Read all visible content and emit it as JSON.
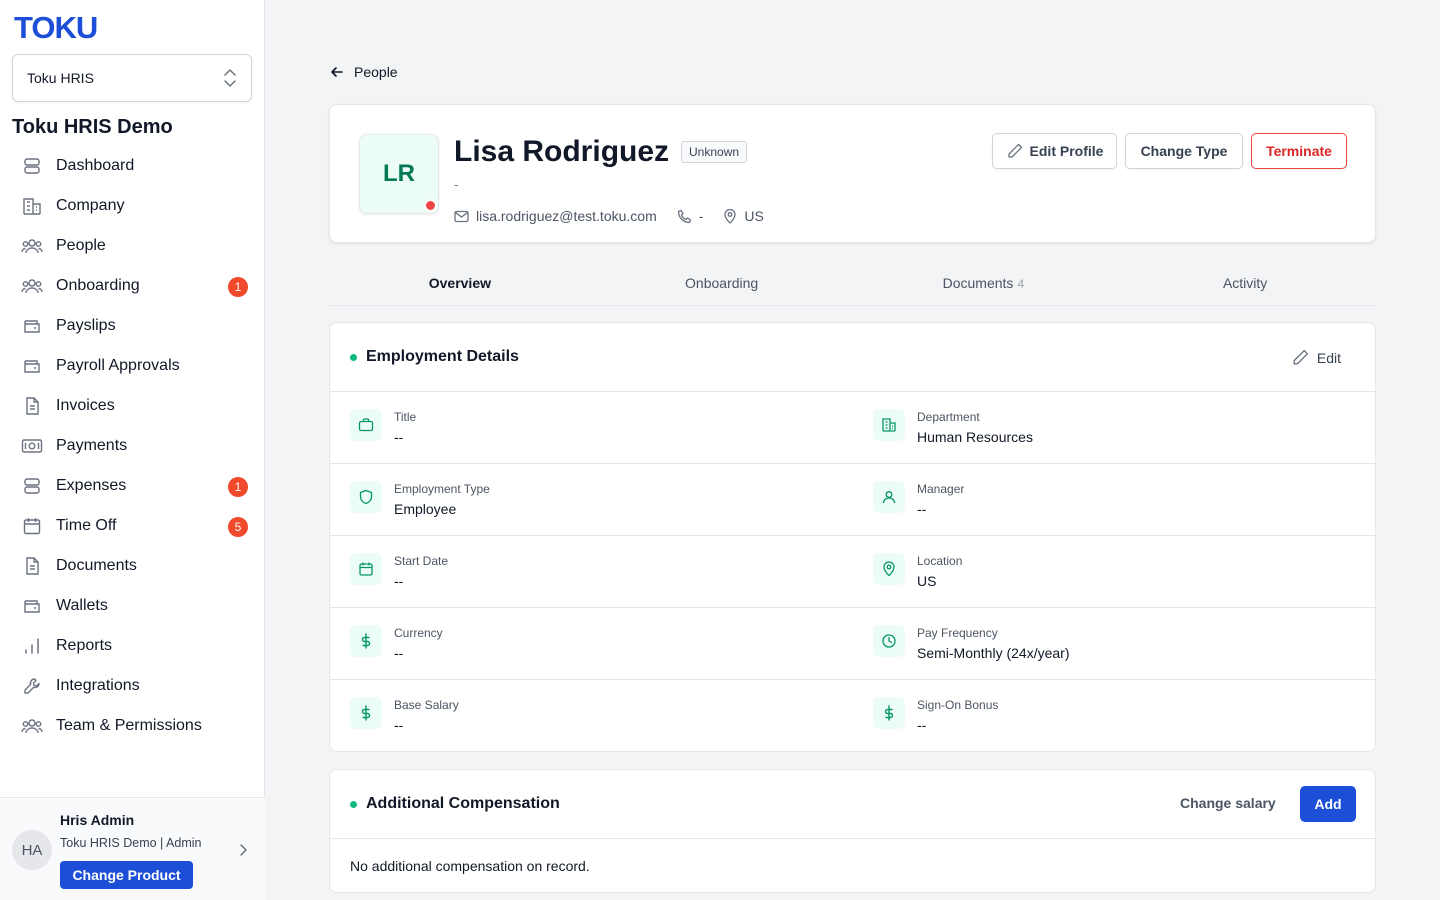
{
  "brand": {
    "logo": "TOKU",
    "accent": "#1d4ed8"
  },
  "sidebar": {
    "product_selector": "Toku HRIS",
    "org_name": "Toku HRIS Demo",
    "items": [
      {
        "label": "Dashboard",
        "icon": "dashboard-icon"
      },
      {
        "label": "Company",
        "icon": "building-icon"
      },
      {
        "label": "People",
        "icon": "users-icon"
      },
      {
        "label": "Onboarding",
        "icon": "users-icon",
        "badge": "1"
      },
      {
        "label": "Payslips",
        "icon": "wallet-icon"
      },
      {
        "label": "Payroll Approvals",
        "icon": "wallet-icon"
      },
      {
        "label": "Invoices",
        "icon": "document-icon"
      },
      {
        "label": "Payments",
        "icon": "banknote-icon"
      },
      {
        "label": "Expenses",
        "icon": "stack-icon",
        "badge": "1"
      },
      {
        "label": "Time Off",
        "icon": "calendar-icon",
        "badge": "5"
      },
      {
        "label": "Documents",
        "icon": "document-icon"
      },
      {
        "label": "Wallets",
        "icon": "wallet-icon"
      },
      {
        "label": "Reports",
        "icon": "bar-chart-icon"
      },
      {
        "label": "Integrations",
        "icon": "wrench-icon"
      },
      {
        "label": "Team & Permissions",
        "icon": "users-icon"
      }
    ],
    "user": {
      "initials": "HA",
      "name": "Hris Admin",
      "org_role": "Toku HRIS Demo | Admin",
      "change_product": "Change Product"
    }
  },
  "breadcrumb": {
    "back_label": "People"
  },
  "profile": {
    "initials": "LR",
    "name": "Lisa Rodriguez",
    "status_badge": "Unknown",
    "subtitle": "-",
    "email": "lisa.rodriguez@test.toku.com",
    "phone": "-",
    "location": "US",
    "actions": {
      "edit": "Edit Profile",
      "change_type": "Change Type",
      "terminate": "Terminate"
    }
  },
  "tabs": [
    {
      "label": "Overview",
      "active": true
    },
    {
      "label": "Onboarding"
    },
    {
      "label": "Documents",
      "count": "4"
    },
    {
      "label": "Activity"
    }
  ],
  "employment": {
    "title": "Employment Details",
    "edit_label": "Edit",
    "rows": [
      [
        {
          "label": "Title",
          "value": "--",
          "icon": "briefcase-icon"
        },
        {
          "label": "Department",
          "value": "Human Resources",
          "icon": "building-icon"
        }
      ],
      [
        {
          "label": "Employment Type",
          "value": "Employee",
          "icon": "shield-icon"
        },
        {
          "label": "Manager",
          "value": "--",
          "icon": "user-icon"
        }
      ],
      [
        {
          "label": "Start Date",
          "value": "--",
          "icon": "calendar-icon"
        },
        {
          "label": "Location",
          "value": "US",
          "icon": "map-pin-icon"
        }
      ],
      [
        {
          "label": "Currency",
          "value": "--",
          "icon": "dollar-icon"
        },
        {
          "label": "Pay Frequency",
          "value": "Semi-Monthly (24x/year)",
          "icon": "clock-icon"
        }
      ],
      [
        {
          "label": "Base Salary",
          "value": "--",
          "icon": "dollar-icon"
        },
        {
          "label": "Sign-On Bonus",
          "value": "--",
          "icon": "dollar-icon"
        }
      ]
    ]
  },
  "compensation": {
    "title": "Additional Compensation",
    "change_salary": "Change salary",
    "add": "Add",
    "empty": "No additional compensation on record."
  }
}
